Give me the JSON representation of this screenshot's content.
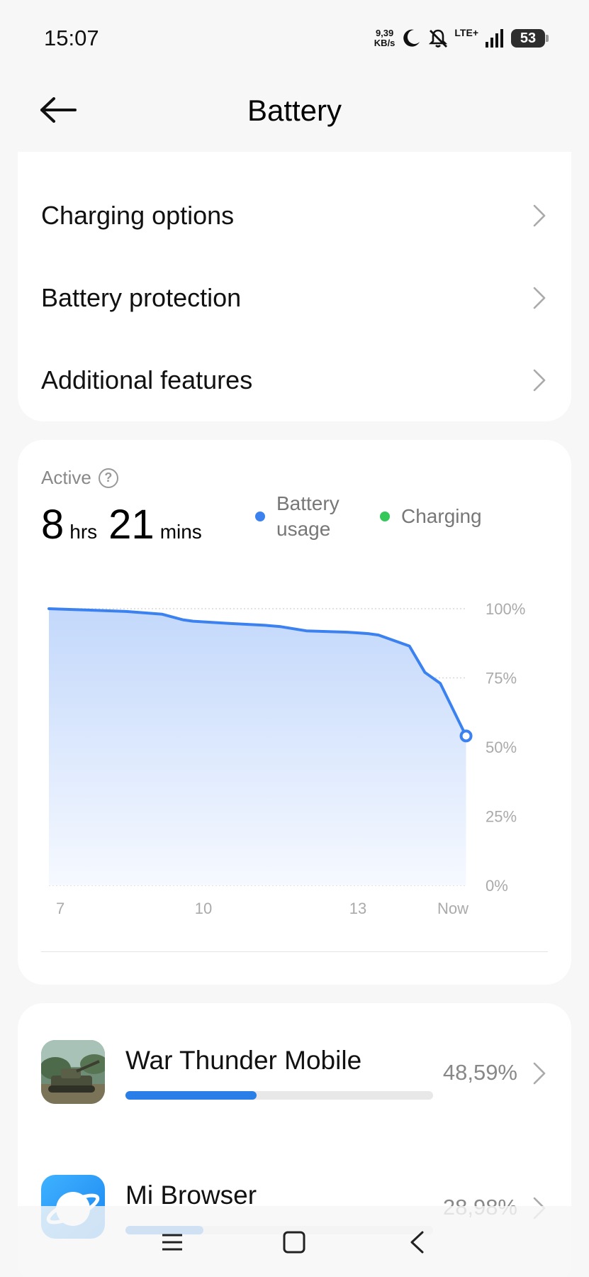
{
  "status_bar": {
    "time": "15:07",
    "net_speed_value": "9,39",
    "net_speed_unit": "KB/s",
    "network": "LTE+",
    "battery_level": "53"
  },
  "header": {
    "title": "Battery"
  },
  "settings": {
    "items": [
      {
        "label": "Charging options"
      },
      {
        "label": "Battery protection"
      },
      {
        "label": "Additional features"
      }
    ]
  },
  "usage": {
    "active_label": "Active",
    "hours": "8",
    "hours_unit": "hrs",
    "minutes": "21",
    "minutes_unit": "mins",
    "legend": {
      "battery_usage_line1": "Battery",
      "battery_usage_line2": "usage",
      "charging": "Charging"
    }
  },
  "colors": {
    "battery_usage": "#3b82f0",
    "charging": "#34c759"
  },
  "chart_data": {
    "type": "area",
    "title": "",
    "xlabel": "",
    "ylabel": "",
    "x_tick_labels": [
      "7",
      "10",
      "13",
      "Now"
    ],
    "y_tick_labels": [
      "100%",
      "75%",
      "50%",
      "25%",
      "0%"
    ],
    "ylim": [
      0,
      100
    ],
    "grid": true,
    "series": [
      {
        "name": "Battery usage",
        "x_hours": [
          7.0,
          7.5,
          8.5,
          9.2,
          9.6,
          9.8,
          10.5,
          11.2,
          11.5,
          12.0,
          12.8,
          13.2,
          13.4,
          14.0,
          14.3,
          14.6,
          15.1
        ],
        "values": [
          100,
          99.7,
          99,
          98,
          96,
          95.5,
          94.7,
          94,
          93.5,
          92,
          91.5,
          91,
          90.5,
          86.5,
          77,
          73,
          54
        ]
      }
    ]
  },
  "apps": [
    {
      "name": "War Thunder Mobile",
      "percent": "48,59%",
      "share": 0.4259
    },
    {
      "name": "Mi Browser",
      "percent": "28,98%",
      "share": 0.254
    }
  ]
}
